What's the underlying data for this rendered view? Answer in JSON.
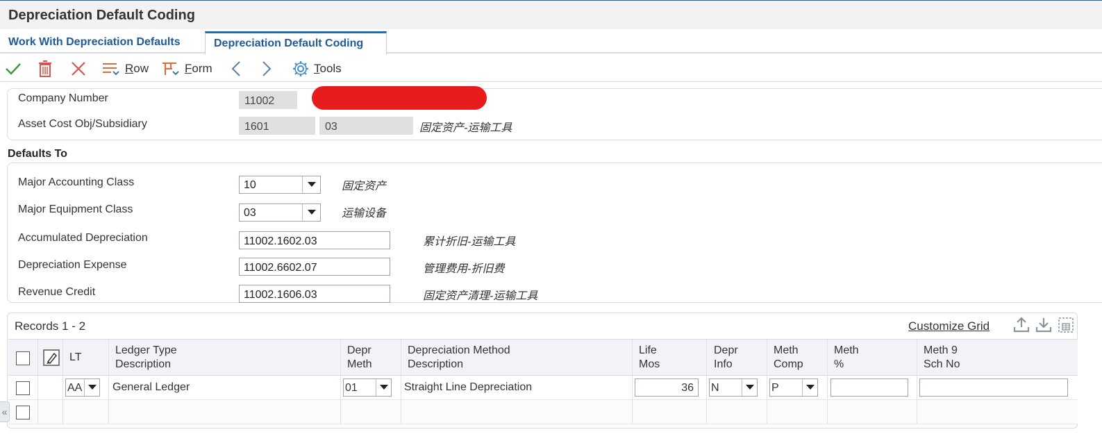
{
  "window": {
    "title": "Depreciation Default Coding"
  },
  "tabs": [
    {
      "label": "Work With Depreciation Defaults"
    },
    {
      "label": "Depreciation Default Coding"
    }
  ],
  "toolbar": {
    "ok_icon": "checkmark-icon",
    "delete_icon": "trash-icon",
    "cancel_icon": "close-icon",
    "row_label_first": "R",
    "row_label_rest": "ow",
    "form_label_first": "F",
    "form_label_rest": "orm",
    "tools_label_first": "T",
    "tools_label_rest": "ools"
  },
  "header": {
    "company_number_label": "Company Number",
    "company_number_value": "11002",
    "asset_cost_label": "Asset Cost Obj/Subsidiary",
    "asset_cost_obj": "1601",
    "asset_cost_sub": "03",
    "asset_cost_desc": "固定资产-运输工具"
  },
  "defaults": {
    "section_title": "Defaults To",
    "major_accounting_class_label": "Major Accounting Class",
    "major_accounting_class_value": "10",
    "major_accounting_class_desc": "固定资产",
    "major_equipment_class_label": "Major Equipment Class",
    "major_equipment_class_value": "03",
    "major_equipment_class_desc": "运输设备",
    "accumulated_depreciation_label": "Accumulated Depreciation",
    "accumulated_depreciation_value": "11002.1602.03",
    "accumulated_depreciation_desc": "累计折旧-运输工具",
    "depreciation_expense_label": "Depreciation Expense",
    "depreciation_expense_value": "11002.6602.07",
    "depreciation_expense_desc": "管理费用-折旧费",
    "revenue_credit_label": "Revenue Credit",
    "revenue_credit_value": "11002.1606.03",
    "revenue_credit_desc": "固定资产清理-运输工具"
  },
  "grid": {
    "records_label": "Records 1 - 2",
    "customize_label": "Customize Grid",
    "columns": {
      "lt": "LT",
      "ledger_type_1": "Ledger Type",
      "ledger_type_2": "Description",
      "depr_meth_1": "Depr",
      "depr_meth_2": "Meth",
      "depr_method_desc_1": "Depreciation Method",
      "depr_method_desc_2": "Description",
      "life_mos_1": "Life",
      "life_mos_2": "Mos",
      "depr_info_1": "Depr",
      "depr_info_2": "Info",
      "meth_comp_1": "Meth",
      "meth_comp_2": "Comp",
      "meth_pct_1": "Meth",
      "meth_pct_2": "%",
      "meth9_1": "Meth 9",
      "meth9_2": "Sch No"
    },
    "rows": [
      {
        "lt": "AA",
        "ledger_type_desc": "General Ledger",
        "depr_meth": "01",
        "depr_method_desc": "Straight Line Depreciation",
        "life_mos": "36",
        "depr_info": "N",
        "meth_comp": "P",
        "meth_pct": "",
        "meth9": ""
      }
    ]
  }
}
